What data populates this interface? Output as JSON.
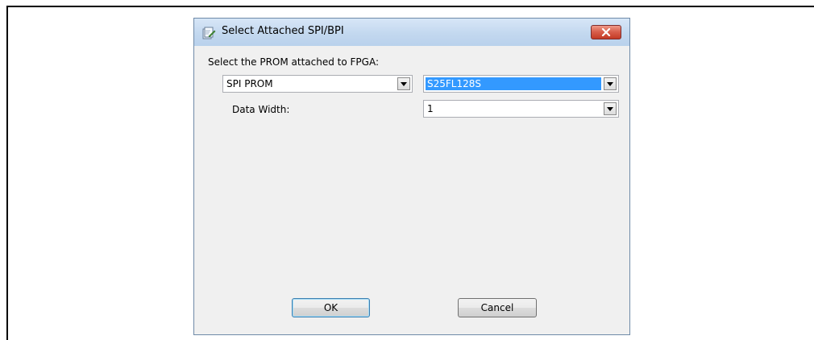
{
  "dialog": {
    "title": "Select Attached SPI/BPI",
    "prompt_label": "Select the PROM attached to FPGA:",
    "prom_type": {
      "value": "SPI PROM"
    },
    "prom_device": {
      "value": "S25FL128S",
      "selected": true
    },
    "data_width": {
      "label": "Data Width:",
      "value": "1"
    },
    "ok_label": "OK",
    "cancel_label": "Cancel"
  },
  "colors": {
    "selection": "#3399ff",
    "titlebar": "#c3d8ef",
    "close_button": "#c33a25"
  },
  "icons": [
    "app-icon",
    "close-icon",
    "dropdown-arrow-icon"
  ]
}
